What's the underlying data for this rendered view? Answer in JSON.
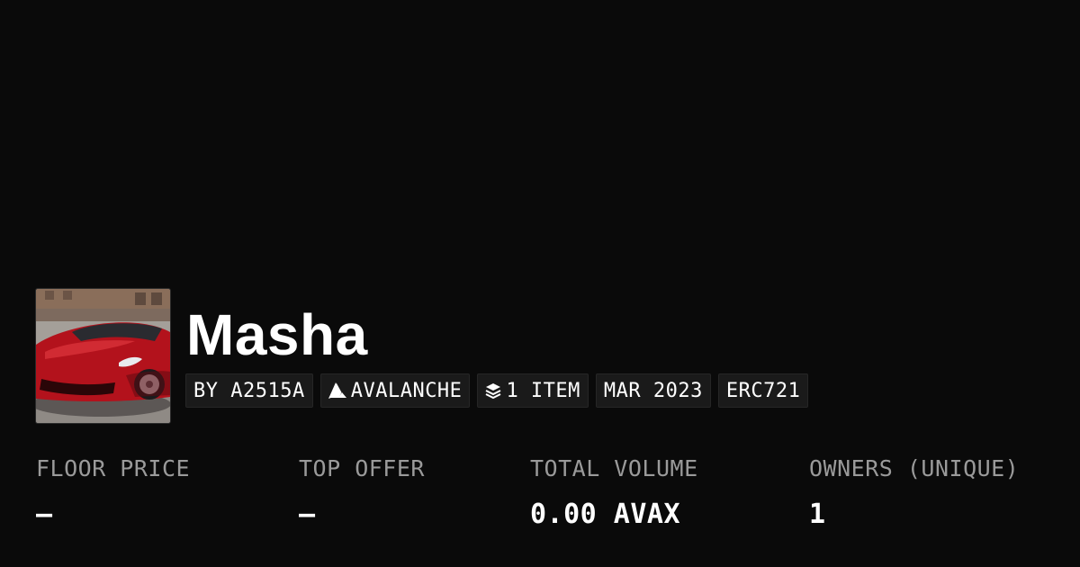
{
  "collection": {
    "name": "Masha",
    "avatar": {
      "icon": "red-sports-car-photo",
      "colors": {
        "sky": "#c9ccd1",
        "building": "#8a6e5a",
        "ground": "#a09a94",
        "car_body": "#b3121c",
        "car_shadow": "#5e0a10"
      }
    }
  },
  "tags": {
    "creator": "BY A2515A",
    "chain": "AVALANCHE",
    "chain_icon": "avalanche-logo-icon",
    "items": "1 ITEM",
    "items_icon": "layers-stack-icon",
    "date": "MAR 2023",
    "standard": "ERC721"
  },
  "stats": {
    "floor_price": {
      "label": "FLOOR PRICE",
      "value": "—"
    },
    "top_offer": {
      "label": "TOP OFFER",
      "value": "—"
    },
    "total_volume": {
      "label": "TOTAL VOLUME",
      "value": "0.00 AVAX"
    },
    "owners": {
      "label": "OWNERS (UNIQUE)",
      "value": "1"
    }
  },
  "colors": {
    "background": "#0a0a0a",
    "tag_background": "#1a1a1a",
    "label": "#9a9a9a",
    "text": "#ffffff"
  }
}
